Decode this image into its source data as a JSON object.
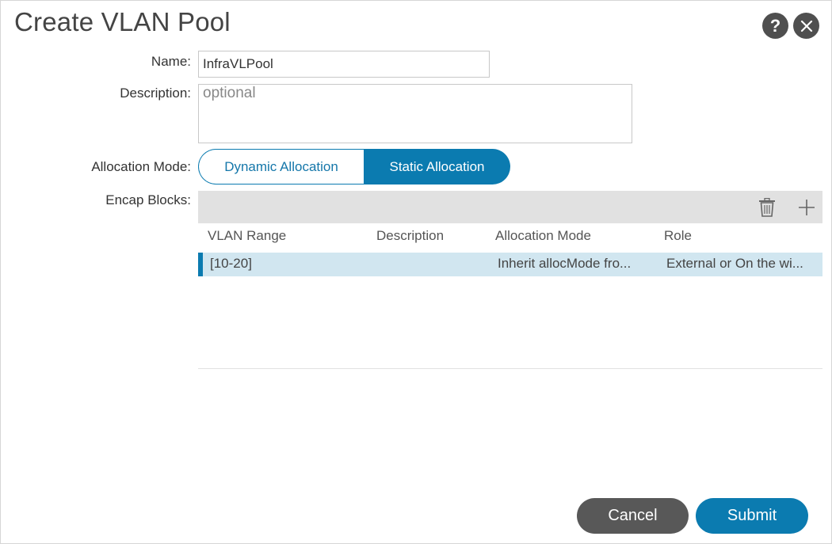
{
  "dialog": {
    "title": "Create VLAN Pool",
    "help_icon": "question-icon",
    "close_icon": "close-icon"
  },
  "form": {
    "name_label": "Name:",
    "name_value": "InfraVLPool",
    "description_label": "Description:",
    "description_placeholder": "optional",
    "allocation_mode_label": "Allocation Mode:",
    "allocation_options": [
      "Dynamic Allocation",
      "Static Allocation"
    ],
    "allocation_selected": "Static Allocation",
    "encap_blocks_label": "Encap Blocks:"
  },
  "encap_table": {
    "toolbar_icons": [
      "trash-icon",
      "plus-icon"
    ],
    "columns": [
      "VLAN Range",
      "Description",
      "Allocation Mode",
      "Role"
    ],
    "rows": [
      {
        "vlan_range": "[10-20]",
        "description": "",
        "allocation_mode": "Inherit allocMode fro...",
        "role": "External or On the wi..."
      }
    ]
  },
  "footer": {
    "cancel_label": "Cancel",
    "submit_label": "Submit"
  },
  "colors": {
    "accent": "#0b7bb0",
    "selected_row": "#d1e6f0",
    "toolbar_bg": "#e1e1e1",
    "dark_button": "#585858"
  }
}
